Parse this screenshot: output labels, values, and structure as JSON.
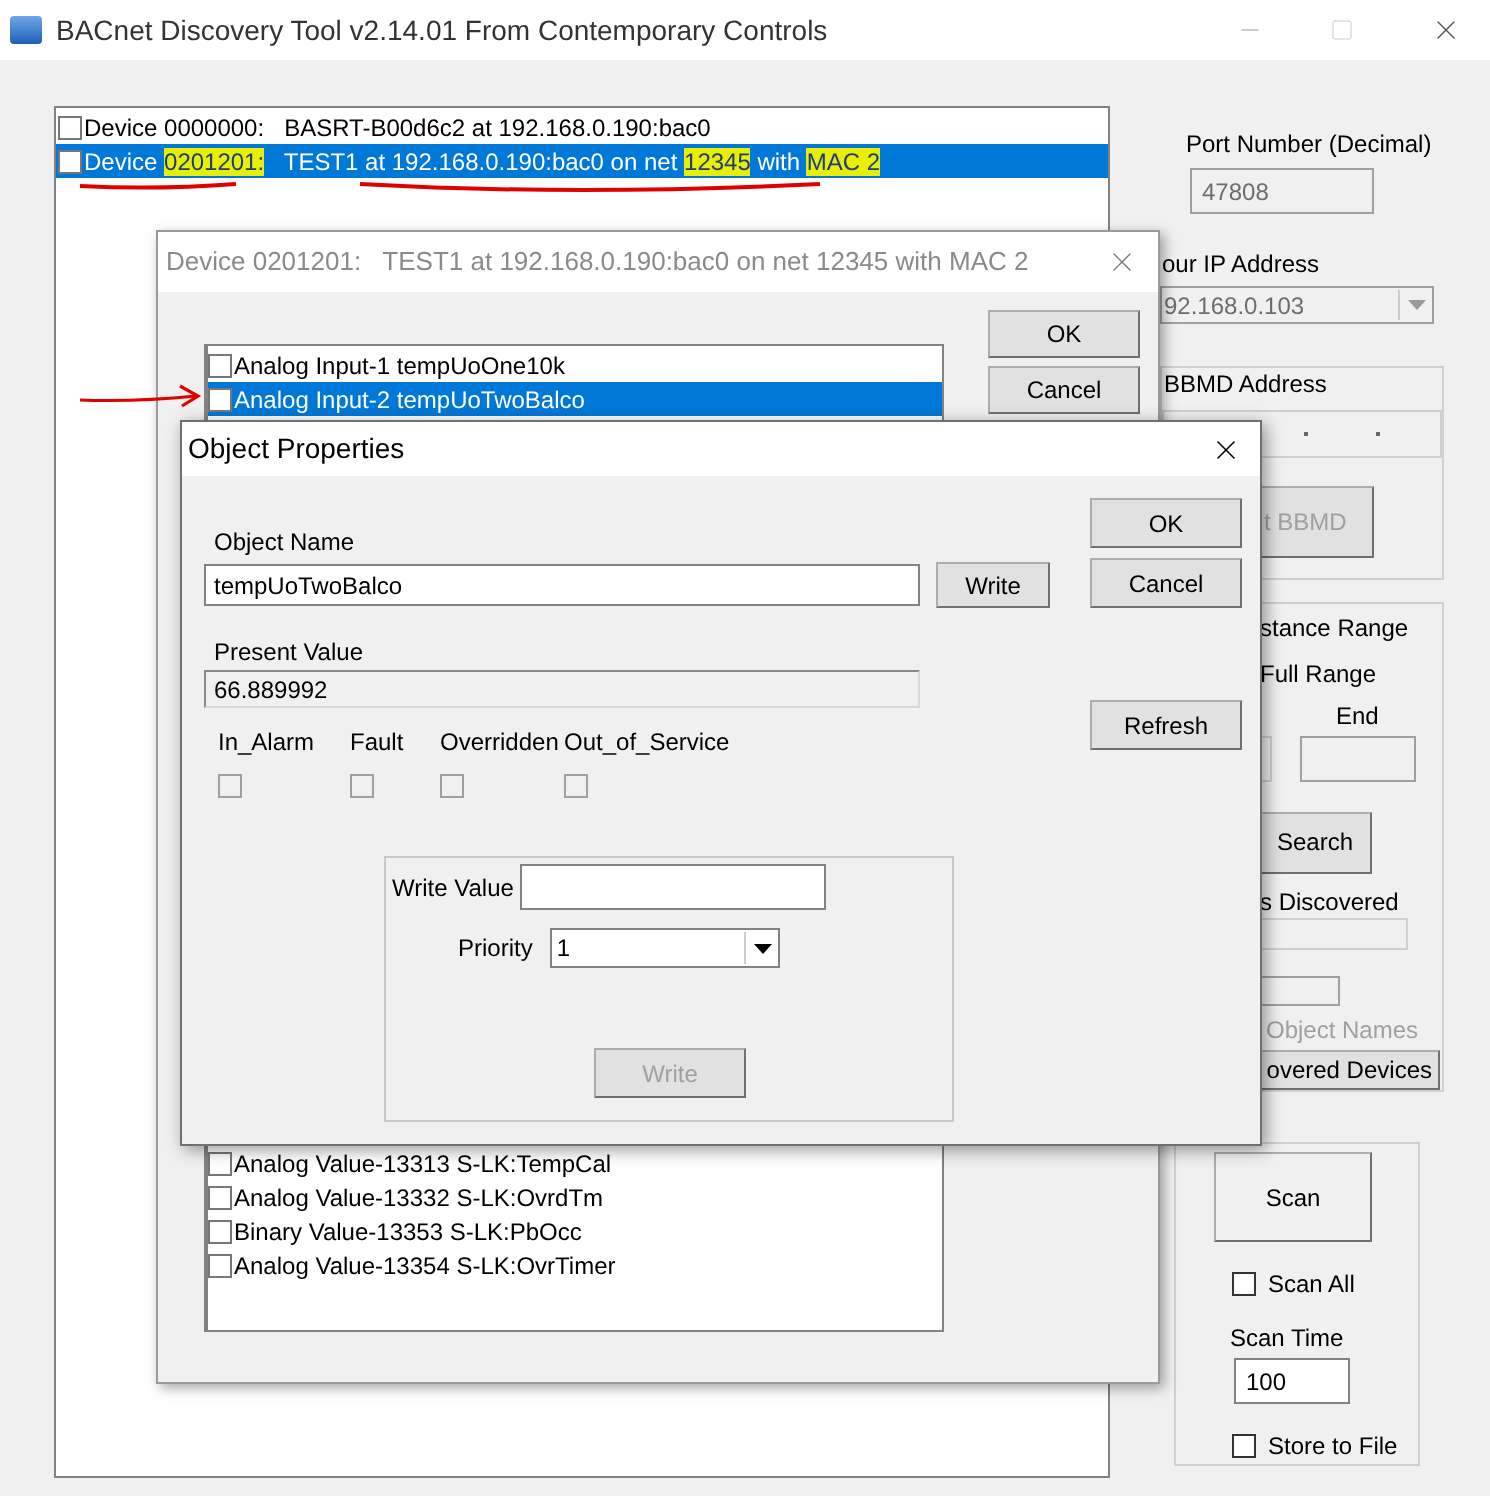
{
  "window": {
    "title": "BACnet Discovery Tool v2.14.01 From Contemporary Controls"
  },
  "devices": [
    {
      "checked": false,
      "selected": false,
      "segments": [
        {
          "text": "Device 0000000:   BASRT-B00d6c2 at 192.168.0.190:bac0",
          "highlighted": false
        }
      ]
    },
    {
      "checked": false,
      "selected": true,
      "segments": [
        {
          "text": "Device ",
          "highlighted": false
        },
        {
          "text": "0201201:",
          "highlighted": true
        },
        {
          "text": "   TEST1 at 192.168.0.190:bac0 on net ",
          "highlighted": false
        },
        {
          "text": "12345",
          "highlighted": true
        },
        {
          "text": " with ",
          "highlighted": false
        },
        {
          "text": "MAC 2",
          "highlighted": true
        }
      ]
    }
  ],
  "settings": {
    "port_label": "Port Number (Decimal)",
    "port_value": "47808",
    "ip_label": "our IP Address",
    "ip_value": "92.168.0.103",
    "bbmd_label": "BBMD Address",
    "bbmd_button": {
      "label": "t BBMD",
      "disabled": true
    },
    "instance_range_label": "stance Range",
    "full_range_label": "Full Range",
    "end_label": "End",
    "search_button": "Search",
    "discovered_label": "s Discovered",
    "object_names": {
      "label": "Object Names",
      "disabled": true
    },
    "discovered_devices_button": "overed Devices",
    "scan_button": "Scan",
    "scan_all": {
      "label": "Scan All",
      "checked": false
    },
    "scan_time_label": "Scan Time",
    "scan_time_value": "100",
    "store_to_file": {
      "label": "Store to File",
      "checked": false
    }
  },
  "device_dialog": {
    "title": "Device 0201201:   TEST1 at 192.168.0.190:bac0 on net 12345 with MAC 2",
    "buttons": [
      "OK",
      "Cancel"
    ],
    "objects_top": [
      {
        "label": "Analog Input-1 tempUoOne10k",
        "checked": false,
        "selected": false
      },
      {
        "label": "Analog Input-2 tempUoTwoBalco",
        "checked": false,
        "selected": true
      }
    ],
    "objects_bottom": [
      {
        "label": "Analog Value-13313 S-LK:TempCal",
        "checked": false,
        "selected": false
      },
      {
        "label": "Analog Value-13332 S-LK:OvrdTm",
        "checked": false,
        "selected": false
      },
      {
        "label": "Binary Value-13353 S-LK:PbOcc",
        "checked": false,
        "selected": false
      },
      {
        "label": "Analog Value-13354 S-LK:OvrTimer",
        "checked": false,
        "selected": false
      }
    ]
  },
  "object_dialog": {
    "title": "Object Properties",
    "object_name_label": "Object Name",
    "object_name_value": "tempUoTwoBalco",
    "write_button": "Write",
    "present_value_label": "Present Value",
    "present_value": "66.889992",
    "flags": [
      {
        "label": "In_Alarm",
        "checked": false,
        "disabled": true
      },
      {
        "label": "Fault",
        "checked": false,
        "disabled": true
      },
      {
        "label": "Overridden",
        "checked": false,
        "disabled": true
      },
      {
        "label": "Out_of_Service",
        "checked": false,
        "disabled": true
      }
    ],
    "buttons": [
      "OK",
      "Cancel"
    ],
    "refresh_button": "Refresh",
    "write_value_label": "Write Value",
    "priority_label": "Priority",
    "priority_value": "1",
    "group_write_button": {
      "label": "Write",
      "disabled": true
    }
  }
}
